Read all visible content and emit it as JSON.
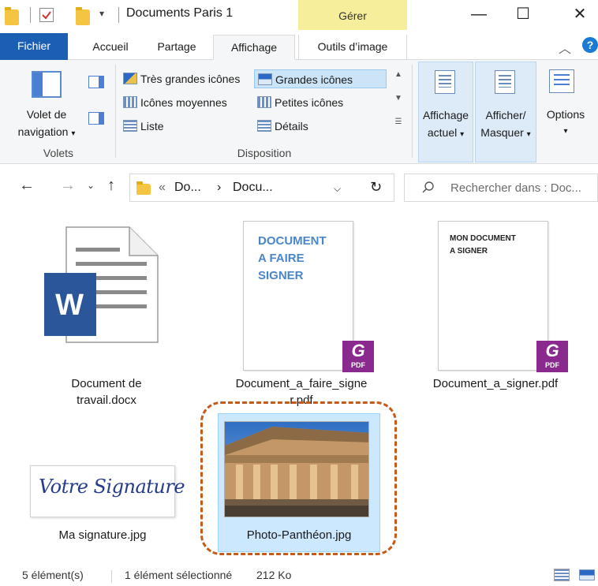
{
  "window": {
    "title": "Documents Paris 1",
    "contextual_tab": "Gérer",
    "minimize": "—",
    "maximize": "☐",
    "close": "✕"
  },
  "ribbon_tabs": [
    {
      "label": "Fichier"
    },
    {
      "label": "Accueil"
    },
    {
      "label": "Partage"
    },
    {
      "label": "Affichage"
    },
    {
      "label": "Outils d’image"
    }
  ],
  "ribbon": {
    "panes": {
      "nav_pane_label_line1": "Volet de",
      "nav_pane_label_line2": "navigation",
      "group_label": "Volets"
    },
    "layout": {
      "group_label": "Disposition",
      "items": [
        {
          "label": "Très grandes icônes",
          "selected": false
        },
        {
          "label": "Grandes icônes",
          "selected": true
        },
        {
          "label": "Icônes moyennes",
          "selected": false
        },
        {
          "label": "Petites icônes",
          "selected": false
        },
        {
          "label": "Liste",
          "selected": false
        },
        {
          "label": "Détails",
          "selected": false
        }
      ]
    },
    "current_view": {
      "line1": "Affichage",
      "line2": "actuel"
    },
    "show_hide": {
      "line1": "Afficher/",
      "line2": "Masquer"
    },
    "options": {
      "label": "Options"
    }
  },
  "address": {
    "segments": [
      "«",
      "Do...",
      "›",
      "Docu..."
    ],
    "search_placeholder": "Rechercher dans : Doc..."
  },
  "files": [
    {
      "name_line1": "Document de",
      "name_line2": "travail.docx",
      "type": "word"
    },
    {
      "name_line1": "Document_a_faire_signe",
      "name_line2": "r.pdf",
      "type": "pdf",
      "thumb_text": [
        "DOCUMENT",
        "A FAIRE",
        "SIGNER"
      ]
    },
    {
      "name_line1": "Document_a_signer.pdf",
      "name_line2": "",
      "type": "pdf",
      "thumb_text": [
        "MON DOCUMENT",
        "A SIGNER"
      ]
    },
    {
      "name_line1": "Ma signature.jpg",
      "name_line2": "",
      "type": "image",
      "thumb_text": [
        "Votre Signature"
      ]
    },
    {
      "name_line1": "Photo-Panthéon.jpg",
      "name_line2": "",
      "type": "image",
      "selected": true
    }
  ],
  "pdf_badge_label": "PDF",
  "word_letter": "W",
  "status": {
    "count": "5 élément(s)",
    "selection": "1 élément sélectionné",
    "size": "212 Ko"
  }
}
